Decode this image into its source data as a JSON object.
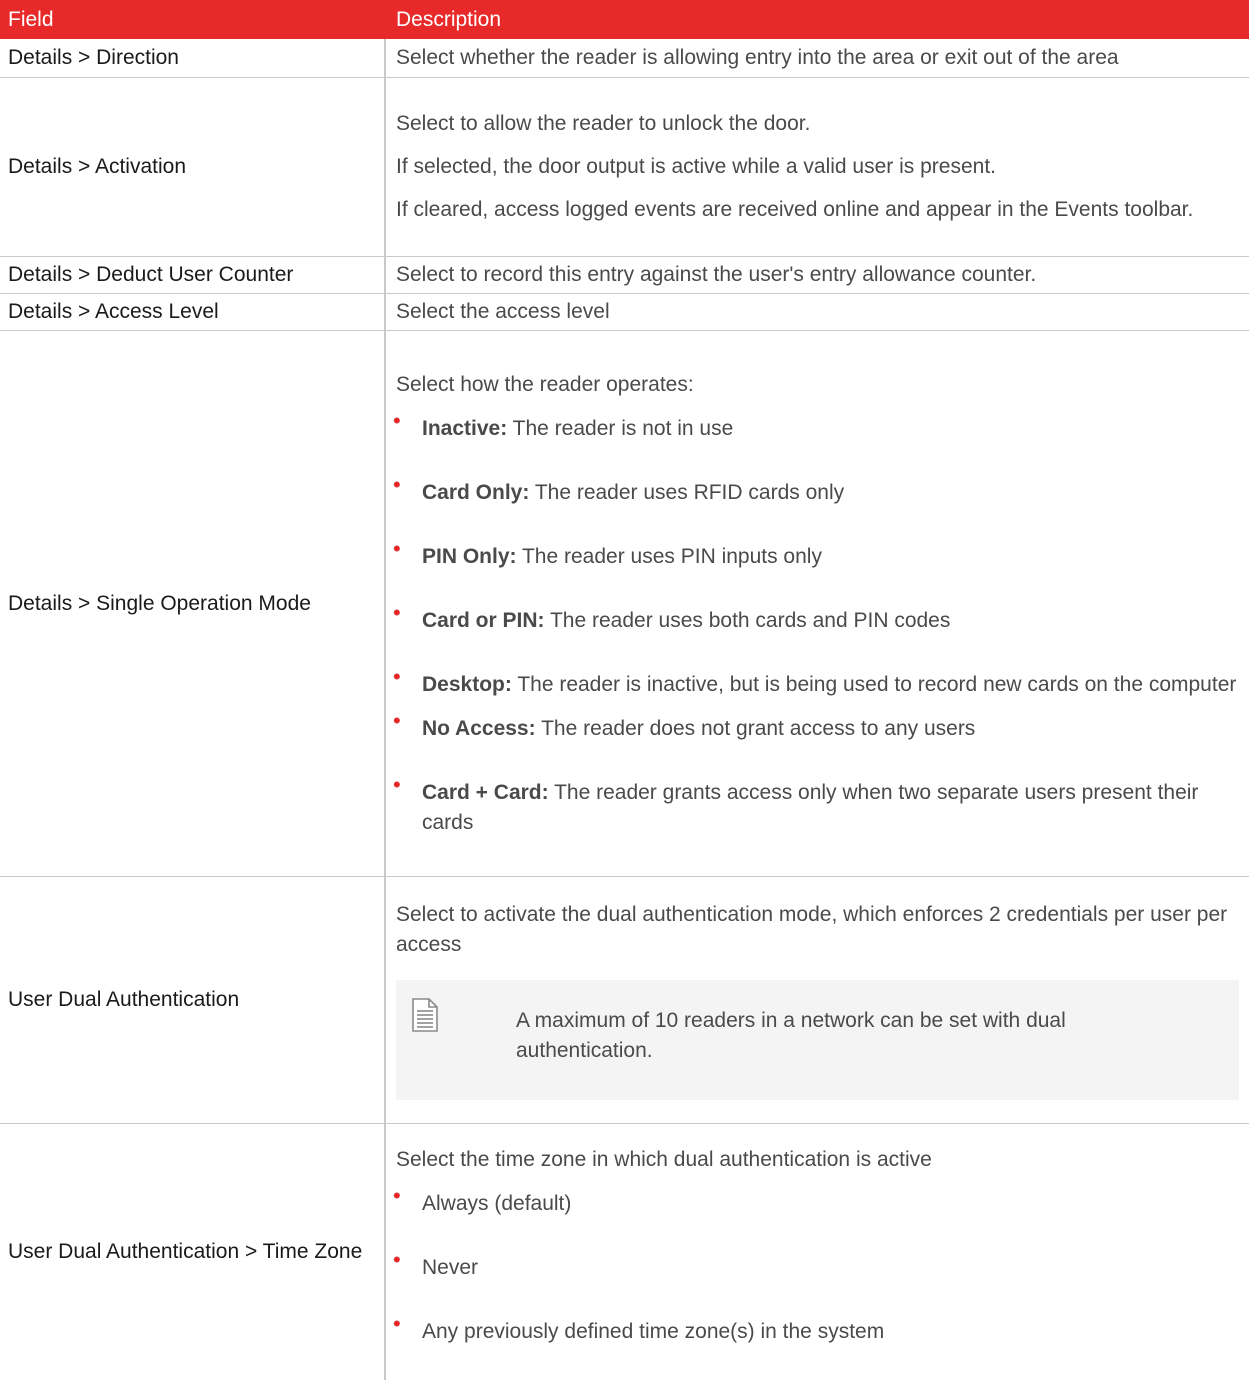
{
  "header": {
    "field": "Field",
    "description": "Description"
  },
  "rows": [
    {
      "field": "Details > Direction",
      "paragraphs": [
        "Select whether the reader is allowing entry into the area or exit out of the area"
      ]
    },
    {
      "field": "Details > Activation",
      "paragraphs": [
        "Select to allow the reader to unlock the door.",
        "If selected, the door output is active while a valid user is present.",
        "If cleared, access logged events are received online and appear in the Events toolbar."
      ]
    },
    {
      "field": "Details > Deduct User Counter",
      "paragraphs": [
        "Select to record this entry against the user's entry allowance counter."
      ]
    },
    {
      "field": "Details > Access Level",
      "paragraphs": [
        "Select the access level"
      ]
    },
    {
      "field": "Details > Single Operation Mode",
      "intro": "Select how the reader operates:",
      "bullets": [
        {
          "term": "Inactive:",
          "text": " The reader is not in use"
        },
        {
          "term": "Card Only:",
          "text": " The reader uses RFID cards only"
        },
        {
          "term": "PIN Only:",
          "text": " The reader uses PIN inputs only"
        },
        {
          "term": "Card or PIN:",
          "text": " The reader uses both cards and PIN codes"
        },
        {
          "term": "Desktop:",
          "text": " The reader is inactive, but is being used to record new cards on the computer"
        },
        {
          "term": "No Access:",
          "text": " The reader does not grant access to any users"
        },
        {
          "term": "Card + Card:",
          "text": " The reader grants access only when two separate users present their cards"
        }
      ]
    },
    {
      "field": "User Dual Authentication",
      "intro": "Select to activate the dual authentication mode, which enforces 2 credentials per user per access",
      "note": "A maximum of 10 readers in a network can be set with dual authentication.",
      "note_icon": "document-note-icon"
    },
    {
      "field": "User Dual Authentication > Time Zone",
      "intro": "Select the time zone in which dual authentication is active",
      "bullets": [
        {
          "text": "Always (default)"
        },
        {
          "text": "Never"
        },
        {
          "text": "Any previously defined time zone(s) in the system"
        }
      ]
    }
  ],
  "colors": {
    "header_bg": "#e8292a",
    "bullet": "#e8292a",
    "note_bg": "#f4f4f4"
  }
}
